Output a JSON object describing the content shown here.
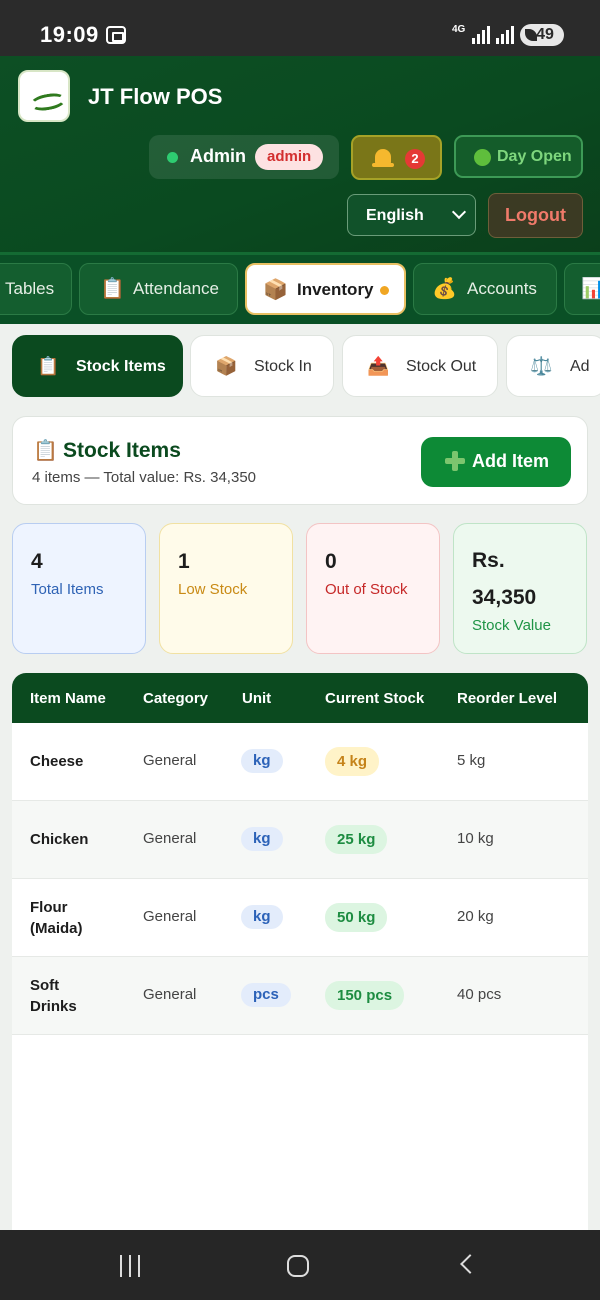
{
  "status_bar": {
    "time": "19:09",
    "network": "4G",
    "battery": "49"
  },
  "header": {
    "app_title": "JT Flow POS",
    "user_name": "Admin",
    "user_role": "admin",
    "notification_count": "2",
    "day_status": "Day Open",
    "language": "English",
    "logout_label": "Logout"
  },
  "nav": {
    "tabs": [
      {
        "label": "Tables",
        "icon": "table-icon"
      },
      {
        "label": "Attendance",
        "icon": "clipboard-icon"
      },
      {
        "label": "Inventory",
        "icon": "package-icon",
        "active": true
      },
      {
        "label": "Accounts",
        "icon": "money-bag-icon"
      },
      {
        "label": "",
        "icon": "chart-icon"
      }
    ]
  },
  "subtabs": [
    {
      "label": "Stock Items",
      "icon": "clipboard-icon",
      "active": true
    },
    {
      "label": "Stock In",
      "icon": "package-icon"
    },
    {
      "label": "Stock Out",
      "icon": "outbox-icon"
    },
    {
      "label": "Ad",
      "icon": "scales-icon"
    }
  ],
  "section": {
    "title": "Stock Items",
    "summary": "4 items — Total value: Rs. 34,350",
    "add_button": "Add Item"
  },
  "stats": [
    {
      "value": "4",
      "label": "Total Items"
    },
    {
      "value": "1",
      "label": "Low Stock"
    },
    {
      "value": "0",
      "label": "Out of Stock"
    },
    {
      "value_line1": "Rs.",
      "value_line2": "34,350",
      "label": "Stock Value"
    }
  ],
  "table": {
    "columns": [
      "Item Name",
      "Category",
      "Unit",
      "Current Stock",
      "Reorder Level"
    ],
    "rows": [
      {
        "name_line1": "Cheese",
        "name_line2": "",
        "category": "General",
        "unit": "kg",
        "stock": "4 kg",
        "reorder": "5 kg",
        "status": "low"
      },
      {
        "name_line1": "Chicken",
        "name_line2": "",
        "category": "General",
        "unit": "kg",
        "stock": "25 kg",
        "reorder": "10 kg",
        "status": "ok"
      },
      {
        "name_line1": "Flour",
        "name_line2": "(Maida)",
        "category": "General",
        "unit": "kg",
        "stock": "50 kg",
        "reorder": "20 kg",
        "status": "ok"
      },
      {
        "name_line1": "Soft",
        "name_line2": "Drinks",
        "category": "General",
        "unit": "pcs",
        "stock": "150 pcs",
        "reorder": "40 pcs",
        "status": "ok"
      }
    ]
  },
  "colors": {
    "header_green": "#0a4a20",
    "primary_green": "#0b4a1f",
    "add_button_green": "#0d8a36",
    "logout_red": "#f07a6a",
    "low_stock_amber": "#c5831a"
  }
}
